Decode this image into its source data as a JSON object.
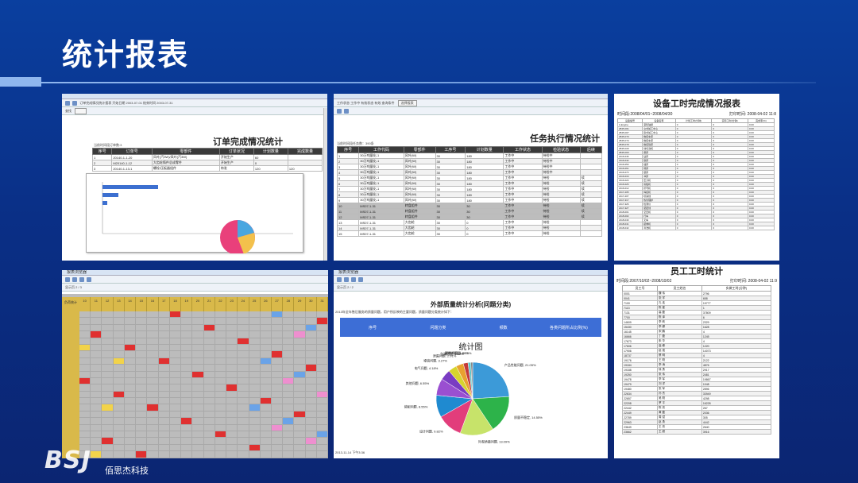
{
  "slide": {
    "title": "统计报表",
    "company": "佰思杰科技",
    "logo_text": "BSJ"
  },
  "panel1": {
    "toolbar_text": "订单完成情况统计报表  开始日期 2003-07-01  结束时间 2003-07-31",
    "search_label": "查找",
    "report_title": "订单完成情况统计",
    "sub": "当前时间段订单数:3",
    "headers": [
      "序号",
      "订单号",
      "零部件",
      "订单状况",
      "计划数量",
      "完成数量"
    ],
    "rows": [
      [
        "1",
        "20140-1-1-20",
        "风叶(汽3W)/风叶(汽3W)",
        "开始生产",
        "60",
        ""
      ],
      [
        "2",
        "M20140-1-12",
        "大齿轮铸件总成零件",
        "开始生产",
        "0",
        ""
      ],
      [
        "3",
        "20140-1-13-1",
        "螺栓/压板器组件",
        "待发",
        "120",
        "120"
      ]
    ]
  },
  "panel2": {
    "toolbar_text": "工作状态  工作中  有效状态  有效  查询条件",
    "button": "选择报表",
    "report_title": "任务执行情况统计",
    "sub": "当前时间段任务数：390条",
    "headers": [
      "序号",
      "工作代码",
      "零部件",
      "工序号",
      "计划数量",
      "工作状态",
      "检验状态",
      "后续"
    ],
    "rows": [
      [
        "1",
        "30万吨量化-1",
        "风叶(W)",
        "30",
        "180",
        "工作中",
        "待检中",
        ""
      ],
      [
        "2",
        "30万吨量化-1",
        "风叶(W)",
        "30",
        "180",
        "工作中",
        "待检中",
        ""
      ],
      [
        "3",
        "30万吨量化-1",
        "风叶(W)",
        "30",
        "180",
        "工作中",
        "待检中",
        ""
      ],
      [
        "4",
        "30万吨量化-1",
        "风叶(W)",
        "30",
        "180",
        "工作中",
        "待检中",
        ""
      ],
      [
        "5",
        "30万吨量化-1",
        "风叶(W)",
        "30",
        "180",
        "工作中",
        "待检",
        "续"
      ],
      [
        "6",
        "30万吨量化-1",
        "风叶(W)",
        "30",
        "180",
        "工作中",
        "待检",
        "续"
      ],
      [
        "7",
        "30万吨量化-1",
        "风叶(W)",
        "30",
        "180",
        "工作中",
        "待检",
        "续"
      ],
      [
        "8",
        "30万吨量化-1",
        "风叶(W)",
        "30",
        "180",
        "工作中",
        "待检",
        "续"
      ],
      [
        "9",
        "30万吨量化-1",
        "风叶(W)",
        "30",
        "180",
        "工作中",
        "待检",
        "续"
      ],
      [
        "10",
        "MS07-1-31",
        "转盘组件",
        "30",
        "30",
        "工作中",
        "待检",
        "续"
      ],
      [
        "11",
        "MS07-1-31",
        "转盘组件",
        "30",
        "30",
        "工作中",
        "待检",
        "续"
      ],
      [
        "12",
        "MS07-1-31",
        "转盘组件",
        "30",
        "30",
        "工作中",
        "待检",
        "续"
      ],
      [
        "13",
        "MS07-1-31",
        "大齿轮",
        "30",
        "0",
        "工作中",
        "待检",
        ""
      ],
      [
        "14",
        "MS07-1-31",
        "大齿轮",
        "30",
        "0",
        "工作中",
        "待检",
        ""
      ],
      [
        "15",
        "MS07-1-31",
        "大齿轮",
        "30",
        "0",
        "工作中",
        "待检",
        ""
      ]
    ]
  },
  "panel3": {
    "report_title": "设备工时完成情况报表",
    "period": "时间段:2008/04/01~2008/04/30",
    "printed": "打印时间: 2008-04-02 11:8",
    "headers": [
      "设备编号",
      "设备名称",
      "计划工时(分钟)",
      "实际工时(分钟)",
      "完成率(%)"
    ],
    "rows": [
      [
        "1-Engine",
        "滚轮轴承",
        "0",
        "0",
        "0.00"
      ],
      [
        "2845-001",
        "立式加工中心",
        "0",
        "0",
        "0.00"
      ],
      [
        "2845-007",
        "卧式加工中心",
        "0",
        "0",
        "0.00"
      ],
      [
        "2845-073",
        "数控车床",
        "0",
        "0",
        "0.00"
      ],
      [
        "2845-074",
        "数控车床",
        "0",
        "0",
        "0.00"
      ],
      [
        "2845-079",
        "数控铣床",
        "0",
        "0",
        "0.00"
      ],
      [
        "2845-020",
        "线切割机",
        "0",
        "0",
        "0.00"
      ],
      [
        "2845-003",
        "磨床",
        "0",
        "0",
        "0.00"
      ],
      [
        "2116-046",
        "钻床",
        "0",
        "0",
        "0.00"
      ],
      [
        "2116-042",
        "刨床",
        "0",
        "0",
        "0.00"
      ],
      [
        "2116-050",
        "插床",
        "0",
        "0",
        "0.00"
      ],
      [
        "2116-061",
        "镗床",
        "0",
        "0",
        "0.00"
      ],
      [
        "2116-073",
        "锯床",
        "0",
        "0",
        "0.00"
      ],
      [
        "2116-016",
        "冲床",
        "0",
        "0",
        "0.00"
      ],
      [
        "2116-023",
        "压力机",
        "0",
        "0",
        "0.00"
      ],
      [
        "2116-026",
        "剪板机",
        "0",
        "0",
        "0.00"
      ],
      [
        "2116-012",
        "折弯机",
        "0",
        "0",
        "0.00"
      ],
      [
        "2117-205",
        "焊接机",
        "0",
        "0",
        "0.00"
      ],
      [
        "2117-207",
        "喷涂线",
        "0",
        "0",
        "0.00"
      ],
      [
        "2117-317",
        "热处理炉",
        "0",
        "0",
        "0.00"
      ],
      [
        "2117-326",
        "检测仪",
        "0",
        "0",
        "0.00"
      ],
      [
        "2117-327",
        "装配线",
        "0",
        "0",
        "0.00"
      ],
      [
        "2118-001",
        "空压机",
        "0",
        "0",
        "0.00"
      ],
      [
        "2118-002",
        "行车",
        "0",
        "0",
        "0.00"
      ],
      [
        "2118-040",
        "叉车",
        "0",
        "0",
        "0.00"
      ],
      [
        "2118-041",
        "起重机",
        "0",
        "0",
        "0.00"
      ],
      [
        "2118-042",
        "清洗机",
        "0",
        "0",
        "0.00"
      ]
    ]
  },
  "panel4": {
    "window_title": "报表浏览器",
    "page_info": "显示页 2 / 3",
    "header_cols": [
      "10",
      "11",
      "12",
      "13",
      "14",
      "15",
      "16",
      "17",
      "18",
      "19",
      "20",
      "21",
      "22",
      "23",
      "24",
      "25",
      "26",
      "27",
      "28",
      "29",
      "30",
      "31"
    ],
    "left_label": "负荷统计"
  },
  "panel5": {
    "window_title": "报表浏览器",
    "page_info": "显示页 2 / 2",
    "page_title": "外部质量统计分析(问题分类)",
    "desc": "2013年全年售后服务的质量问题，用户所反映的主要问题，质量问题分类统计如下：",
    "band": [
      "序号",
      "问题分类",
      "频数",
      "各类问题所占比例(%)"
    ],
    "chart_title": "统计图",
    "timestamp": "2013-11-14 下午3:36"
  },
  "panel6": {
    "report_title": "员工工时统计",
    "period": "时间段:2007/10/02~2008/10/02",
    "printed": "打印时间: 2008-04-02 11:9",
    "headers": [
      "员工号",
      "员工姓名",
      "实做工时(分钟)"
    ],
    "rows": [
      [
        "0001",
        "魏 伟",
        "2796"
      ],
      [
        "0041",
        "张 学",
        "658"
      ],
      [
        "7100",
        "孔 连",
        "19777"
      ],
      [
        "7113",
        "陈 星",
        "1"
      ],
      [
        "7131",
        "高 磊",
        "37809"
      ],
      [
        "7700",
        "陈 泽",
        "6"
      ],
      [
        "14609",
        "李 莉",
        "2329"
      ],
      [
        "15430",
        "李 娜",
        "1628"
      ],
      [
        "16145",
        "宋 鹏",
        "4"
      ],
      [
        "16666",
        "丁 磊",
        "1245"
      ],
      [
        "17673",
        "朱 华",
        "4"
      ],
      [
        "17606",
        "高 峰",
        "1220"
      ],
      [
        "17906",
        "赵 强",
        "14073"
      ],
      [
        "18737",
        "蔡 明",
        "4"
      ],
      [
        "19176",
        "王 刚",
        "2122"
      ],
      [
        "19184",
        "李 涛",
        "4876"
      ],
      [
        "19188",
        "徐 勇",
        "2917"
      ],
      [
        "19250",
        "张 伟",
        "2481"
      ],
      [
        "19478",
        "李 军",
        "19867"
      ],
      [
        "19479",
        "刘 洋",
        "1048"
      ],
      [
        "19480",
        "张 军",
        "2896"
      ],
      [
        "22634",
        "孙 杰",
        "33949"
      ],
      [
        "22657",
        "吴 刚",
        "4298"
      ],
      [
        "22208",
        "罗 平",
        "16228"
      ],
      [
        "22442",
        "陈 亮",
        "267"
      ],
      [
        "22449",
        "黄 磊",
        "2036"
      ],
      [
        "22789",
        "周 斌",
        "305"
      ],
      [
        "22963",
        "赵 勇",
        "4442"
      ],
      [
        "23649",
        "王 亮",
        "2640"
      ],
      [
        "23662",
        "王 超",
        "3916"
      ]
    ]
  },
  "chart_data": {
    "type": "pie",
    "title": "统计图",
    "slices": [
      {
        "label": "产品性能问题",
        "value": 21.05,
        "color": "#3c9ad8"
      },
      {
        "label": "质量不稳定",
        "value": 14.55,
        "color": "#2db34a"
      },
      {
        "label": "外观质量问题",
        "value": 13.09,
        "color": "#c7e36a"
      },
      {
        "label": "设计问题",
        "value": 9.82,
        "color": "#e23d7b"
      },
      {
        "label": "装配问题",
        "value": 8.55,
        "color": "#1f8ad0"
      },
      {
        "label": "其他问题",
        "value": 6.55,
        "color": "#9a4fd1"
      },
      {
        "label": "电气问题",
        "value": 4.18,
        "color": "#7a3cc2"
      },
      {
        "label": "噪音问题",
        "value": 3.27,
        "color": "#d7d42e"
      },
      {
        "label": "泄漏问题",
        "value": 2.91,
        "color": "#e8a22f"
      },
      {
        "label": "包装问题",
        "value": 1.82,
        "color": "#c43a3a"
      },
      {
        "label": "配件问题",
        "value": 1.09,
        "color": "#5ec5c8"
      },
      {
        "label": "说明书问题",
        "value": 0.73,
        "color": "#888888"
      }
    ]
  }
}
